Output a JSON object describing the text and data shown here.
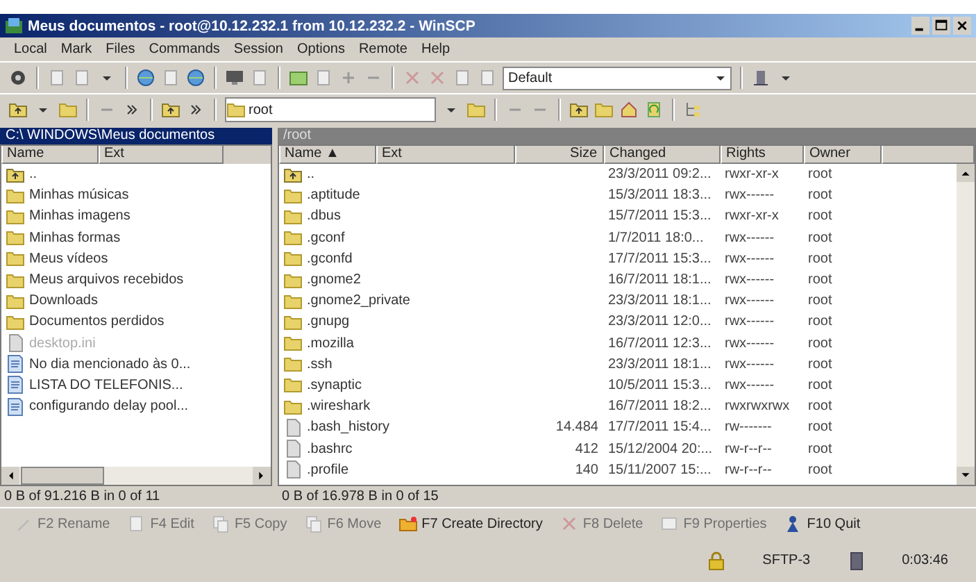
{
  "window": {
    "title": "Meus documentos - root@10.12.232.1 from 10.12.232.2 - WinSCP"
  },
  "menu": [
    "Local",
    "Mark",
    "Files",
    "Commands",
    "Session",
    "Options",
    "Remote",
    "Help"
  ],
  "toolbar": {
    "preset": "Default"
  },
  "address": {
    "value": "root"
  },
  "local_panel": {
    "path": "C:\\ WINDOWS\\Meus documentos",
    "active": true,
    "columns": [
      "Name",
      "Ext"
    ],
    "items": [
      {
        "name": "..",
        "kind": "up",
        "hidden": false
      },
      {
        "name": "Minhas músicas",
        "kind": "folder",
        "hidden": false
      },
      {
        "name": "Minhas imagens",
        "kind": "folder",
        "hidden": false
      },
      {
        "name": "Minhas formas",
        "kind": "folder",
        "hidden": false
      },
      {
        "name": "Meus vídeos",
        "kind": "folder",
        "hidden": false
      },
      {
        "name": "Meus arquivos recebidos",
        "kind": "folder",
        "hidden": false
      },
      {
        "name": "Downloads",
        "kind": "folder",
        "hidden": false
      },
      {
        "name": "Documentos perdidos",
        "kind": "folder",
        "hidden": false
      },
      {
        "name": "desktop.ini",
        "kind": "file",
        "hidden": true
      },
      {
        "name": "No dia mencionado às 0...",
        "kind": "doc",
        "hidden": false
      },
      {
        "name": "LISTA DO TELEFONIS...",
        "kind": "doc",
        "hidden": false
      },
      {
        "name": "configurando delay pool...",
        "kind": "doc",
        "hidden": false
      }
    ],
    "status": "0 B of 91.216 B in 0 of 11"
  },
  "remote_panel": {
    "path": "/root",
    "active": false,
    "columns": [
      "Name ▲",
      "Ext",
      "Size",
      "Changed",
      "Rights",
      "Owner"
    ],
    "items": [
      {
        "name": "..",
        "kind": "up",
        "changed": "23/3/2011 09:2...",
        "rights": "rwxr-xr-x",
        "owner": "root"
      },
      {
        "name": ".aptitude",
        "kind": "folder",
        "changed": "15/3/2011 18:3...",
        "rights": "rwx------",
        "owner": "root"
      },
      {
        "name": ".dbus",
        "kind": "folder",
        "changed": "15/7/2011 15:3...",
        "rights": "rwxr-xr-x",
        "owner": "root"
      },
      {
        "name": ".gconf",
        "kind": "folder",
        "changed": "1/7/2011 18:0...",
        "rights": "rwx------",
        "owner": "root"
      },
      {
        "name": ".gconfd",
        "kind": "folder",
        "changed": "17/7/2011 15:3...",
        "rights": "rwx------",
        "owner": "root"
      },
      {
        "name": ".gnome2",
        "kind": "folder",
        "changed": "16/7/2011 18:1...",
        "rights": "rwx------",
        "owner": "root"
      },
      {
        "name": ".gnome2_private",
        "kind": "folder",
        "changed": "23/3/2011 18:1...",
        "rights": "rwx------",
        "owner": "root"
      },
      {
        "name": ".gnupg",
        "kind": "folder",
        "changed": "23/3/2011 12:0...",
        "rights": "rwx------",
        "owner": "root"
      },
      {
        "name": ".mozilla",
        "kind": "folder",
        "changed": "16/7/2011 12:3...",
        "rights": "rwx------",
        "owner": "root"
      },
      {
        "name": ".ssh",
        "kind": "folder",
        "changed": "23/3/2011 18:1...",
        "rights": "rwx------",
        "owner": "root"
      },
      {
        "name": ".synaptic",
        "kind": "folder",
        "changed": "10/5/2011 15:3...",
        "rights": "rwx------",
        "owner": "root"
      },
      {
        "name": ".wireshark",
        "kind": "folder",
        "changed": "16/7/2011 18:2...",
        "rights": "rwxrwxrwx",
        "owner": "root"
      },
      {
        "name": ".bash_history",
        "kind": "file",
        "size": "14.484",
        "changed": "17/7/2011 15:4...",
        "rights": "rw-------",
        "owner": "root"
      },
      {
        "name": ".bashrc",
        "kind": "file",
        "size": "412",
        "changed": "15/12/2004 20:...",
        "rights": "rw-r--r--",
        "owner": "root"
      },
      {
        "name": ".profile",
        "kind": "file",
        "size": "140",
        "changed": "15/11/2007 15:...",
        "rights": "rw-r--r--",
        "owner": "root"
      }
    ],
    "status": "0 B of 16.978 B in 0 of 15"
  },
  "function_keys": [
    {
      "label": "F2 Rename",
      "disabled": true
    },
    {
      "label": "F4 Edit",
      "disabled": true
    },
    {
      "label": "F5 Copy",
      "disabled": true
    },
    {
      "label": "F6 Move",
      "disabled": true
    },
    {
      "label": "F7 Create Directory",
      "disabled": false
    },
    {
      "label": "F8 Delete",
      "disabled": true
    },
    {
      "label": "F9 Properties",
      "disabled": true
    },
    {
      "label": "F10 Quit",
      "disabled": false
    }
  ],
  "status_bar": {
    "protocol": "SFTP-3",
    "time": "0:03:46"
  }
}
